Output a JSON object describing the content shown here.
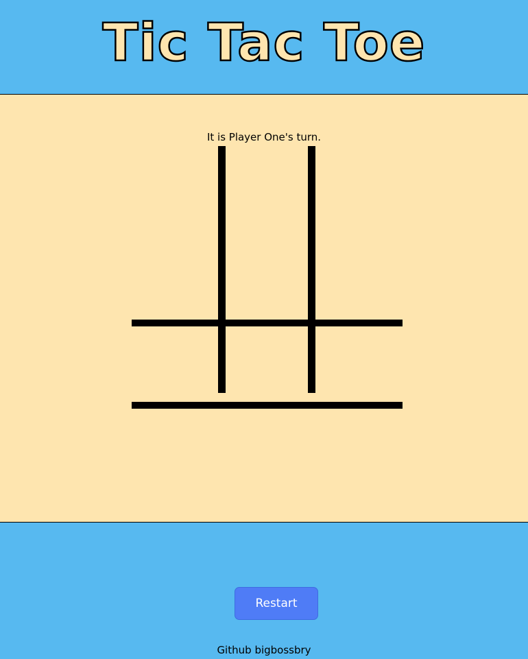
{
  "header": {
    "title": "Tic Tac Toe"
  },
  "game": {
    "status": "It is Player One's turn.",
    "cells": [
      "",
      "",
      "",
      "",
      "",
      "",
      "",
      "",
      ""
    ]
  },
  "footer": {
    "restart_label": "Restart",
    "github_label": "Github",
    "github_user": "bigbossbry"
  },
  "colors": {
    "sky_blue": "#57b9f0",
    "cream": "#fee5af",
    "button_blue": "#4f7cf6"
  }
}
